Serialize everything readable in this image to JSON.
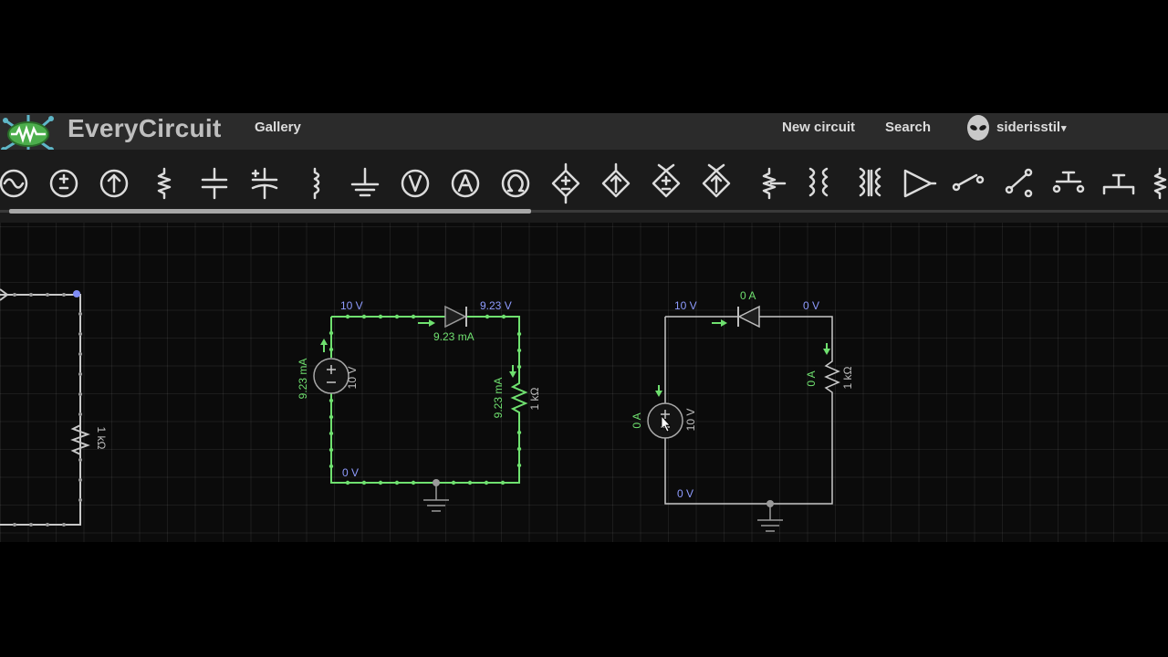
{
  "header": {
    "app_title": "EveryCircuit",
    "nav": {
      "gallery": "Gallery",
      "new_circuit": "New circuit",
      "search": "Search"
    },
    "user": {
      "name": "siderisstil",
      "menu_caret": "▾"
    }
  },
  "toolbar": {
    "items": [
      "ac-source",
      "dc-current-source",
      "dc-voltage-source",
      "resistor",
      "capacitor",
      "polarized-capacitor",
      "inductor",
      "ground",
      "voltmeter",
      "ammeter",
      "ohmmeter",
      "vcvs",
      "vccs",
      "ccvs",
      "cccs",
      "potentiometer",
      "transformer",
      "coupled-inductor",
      "op-amp",
      "spst-switch",
      "spdt-switch",
      "push-button-open",
      "push-button-closed",
      "more"
    ]
  },
  "circuits": {
    "left": {
      "resistor_label": "1 kΩ"
    },
    "middle": {
      "top_left_voltage": "10 V",
      "top_right_voltage": "9.23 V",
      "diode_current": "9.23 mA",
      "source_current": "9.23 mA",
      "source_value": "10 V",
      "resistor_current": "9.23 mA",
      "resistor_value": "1 kΩ",
      "bottom_voltage": "0 V"
    },
    "right": {
      "top_left_voltage": "10 V",
      "diode_current": "0 A",
      "top_right_voltage": "0 V",
      "resistor_current": "0 A",
      "resistor_value": "1 kΩ",
      "source_current": "0 A",
      "source_value": "10 V",
      "bottom_voltage": "0 V"
    }
  },
  "colors": {
    "wire_active": "#6fe06f",
    "wire_idle": "#c8c8c8",
    "voltage_label": "#8f9cff",
    "current_label": "#6fe06f",
    "component_label": "#bdbdbd",
    "topbar": "#2b2b2b"
  }
}
